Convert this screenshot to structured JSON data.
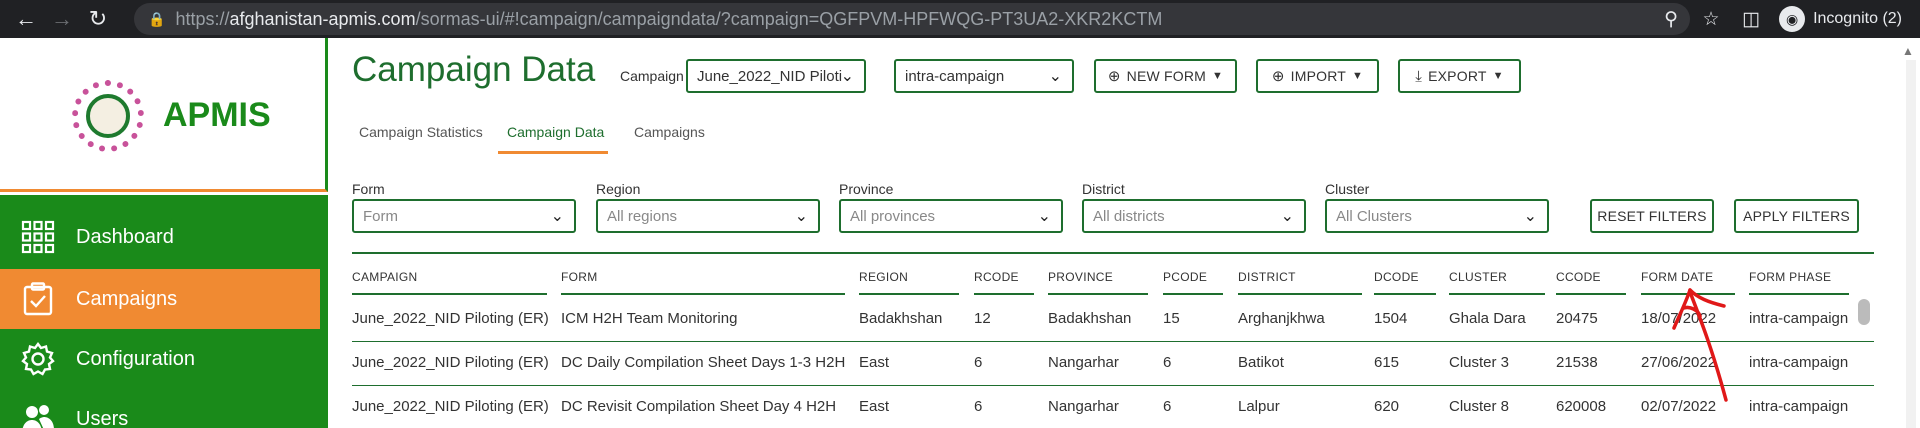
{
  "browser": {
    "url_host": "afghanistan-apmis.com",
    "url_scheme": "https://",
    "url_path": "/sormas-ui/#!campaign/campaigndata/?campaign=QGFPVM-HPFWQG-PT3UA2-XKR2KCTM",
    "incognito_label": "Incognito (2)"
  },
  "sidebar": {
    "app_name": "APMIS",
    "items": [
      {
        "label": "Dashboard",
        "icon": "dashboard-grid-icon"
      },
      {
        "label": "Campaigns",
        "icon": "clipboard-check-icon"
      },
      {
        "label": "Configuration",
        "icon": "gear-icon"
      },
      {
        "label": "Users",
        "icon": "users-icon"
      }
    ]
  },
  "header": {
    "title": "Campaign Data",
    "campaign_label": "Campaign",
    "campaign_value": "June_2022_NID Piloti",
    "phase_value": "intra-campaign",
    "new_form_label": "NEW FORM",
    "import_label": "IMPORT",
    "export_label": "EXPORT"
  },
  "tabs": [
    {
      "label": "Campaign Statistics"
    },
    {
      "label": "Campaign Data"
    },
    {
      "label": "Campaigns"
    }
  ],
  "filters": {
    "form": {
      "label": "Form",
      "placeholder": "Form"
    },
    "region": {
      "label": "Region",
      "placeholder": "All regions"
    },
    "province": {
      "label": "Province",
      "placeholder": "All provinces"
    },
    "district": {
      "label": "District",
      "placeholder": "All districts"
    },
    "cluster": {
      "label": "Cluster",
      "placeholder": "All Clusters"
    },
    "reset_label": "RESET FILTERS",
    "apply_label": "APPLY FILTERS"
  },
  "table": {
    "headers": [
      "CAMPAIGN",
      "FORM",
      "REGION",
      "RCODE",
      "PROVINCE",
      "PCODE",
      "DISTRICT",
      "DCODE",
      "CLUSTER",
      "CCODE",
      "FORM DATE",
      "FORM PHASE"
    ],
    "rows": [
      [
        "June_2022_NID Piloting (ER)",
        "ICM H2H Team Monitoring",
        "Badakhshan",
        "12",
        "Badakhshan",
        "15",
        "Arghanjkhwa",
        "1504",
        "Ghala Dara",
        "20475",
        "18/07/2022",
        "intra-campaign"
      ],
      [
        "June_2022_NID Piloting (ER)",
        "DC Daily Compilation Sheet Days 1-3 H2H",
        "East",
        "6",
        "Nangarhar",
        "6",
        "Batikot",
        "615",
        "Cluster 3",
        "21538",
        "27/06/2022",
        "intra-campaign"
      ],
      [
        "June_2022_NID Piloting (ER)",
        "DC Revisit Compilation Sheet Day 4 H2H",
        "East",
        "6",
        "Nangarhar",
        "6",
        "Lalpur",
        "620",
        "Cluster 8",
        "620008",
        "02/07/2022",
        "intra-campaign"
      ]
    ]
  },
  "colors": {
    "brand_green": "#1a8a1a",
    "accent_orange": "#f08a32",
    "annotation_red": "#e01818"
  }
}
